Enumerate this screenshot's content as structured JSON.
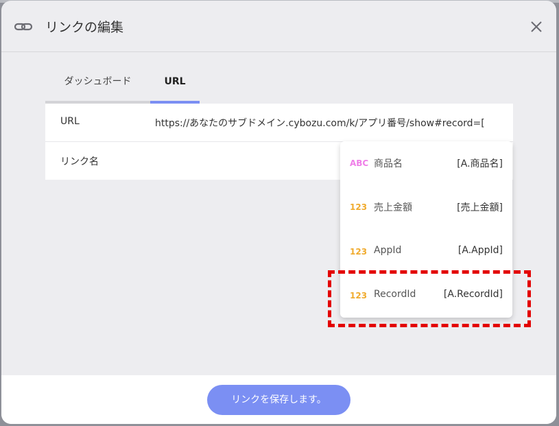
{
  "dialog": {
    "title": "リンクの編集",
    "icons": {
      "title_icon": "link-icon",
      "close_icon": "close-icon"
    }
  },
  "tabs": [
    {
      "label": "ダッシュボード",
      "active": false
    },
    {
      "label": "URL",
      "active": true
    }
  ],
  "form": {
    "url_label": "URL",
    "url_value": "https://あなたのサブドメイン.cybozu.com/k/アプリ番号/show#record=[",
    "link_name_label": "リンク名",
    "link_name_value": ""
  },
  "dropdown": {
    "items": [
      {
        "badge": "ABC",
        "type": "text",
        "name": "商品名",
        "code": "[A.商品名]"
      },
      {
        "badge": "123",
        "type": "number",
        "name": "売上金額",
        "code": "[売上金額]"
      },
      {
        "badge": "123",
        "type": "number",
        "name": "AppId",
        "code": "[A.AppId]"
      },
      {
        "badge": "123",
        "type": "number",
        "name": "RecordId",
        "code": "[A.RecordId]"
      }
    ],
    "highlighted": "RecordId"
  },
  "footer": {
    "save_label": "リンクを保存します。"
  },
  "colors": {
    "accent": "#7b8ff3",
    "text_badge": "#ef7ee8",
    "number_badge": "#f0ab2e",
    "highlight": "#e30000"
  }
}
